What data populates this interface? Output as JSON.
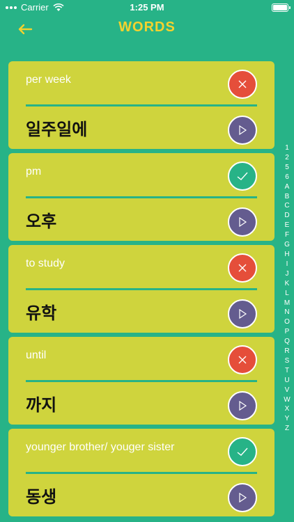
{
  "status_bar": {
    "carrier": "Carrier",
    "time": "1:25 PM"
  },
  "header": {
    "title": "WORDS",
    "back_icon": "arrow-left-icon"
  },
  "colors": {
    "background": "#27b387",
    "card": "#cfd43d",
    "title": "#f4d22e",
    "wrong": "#e54e3a",
    "right": "#27b387",
    "play": "#645c8f"
  },
  "words": [
    {
      "english": "per week",
      "korean": "일주일에",
      "status": "wrong"
    },
    {
      "english": "pm",
      "korean": "오후",
      "status": "right"
    },
    {
      "english": "to study",
      "korean": "유학",
      "status": "wrong"
    },
    {
      "english": "until",
      "korean": "까지",
      "status": "wrong"
    },
    {
      "english": "younger brother/ youger sister",
      "korean": "동생",
      "status": "right"
    }
  ],
  "index": [
    "1",
    "2",
    "5",
    "6",
    "A",
    "B",
    "C",
    "D",
    "E",
    "F",
    "G",
    "H",
    "I",
    "J",
    "K",
    "L",
    "M",
    "N",
    "O",
    "P",
    "Q",
    "R",
    "S",
    "T",
    "U",
    "V",
    "W",
    "X",
    "Y",
    "Z"
  ]
}
